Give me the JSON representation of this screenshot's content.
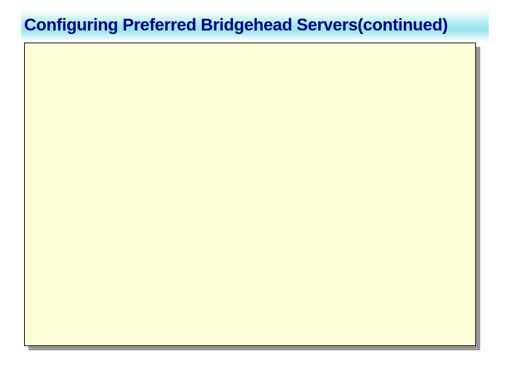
{
  "slide": {
    "title_main": "Configuring Preferred Bridgehead Servers",
    "title_continued": "(continued)"
  }
}
